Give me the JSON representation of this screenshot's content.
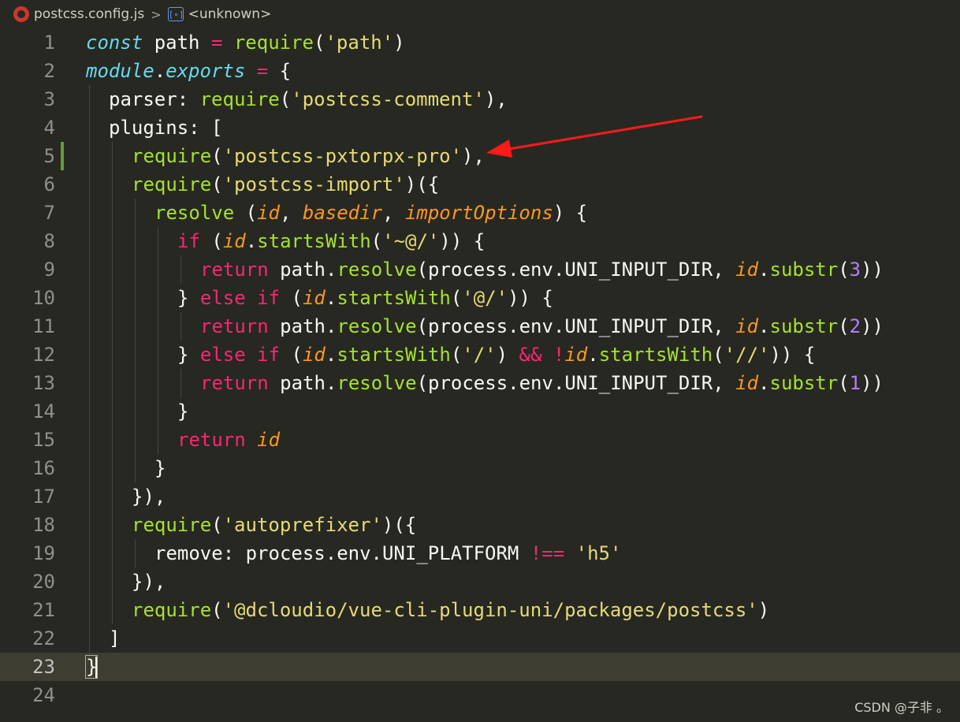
{
  "breadcrumb": {
    "file_icon": "postcss-file-icon",
    "file_name": "postcss.config.js",
    "separator": ">",
    "symbol_icon": "symbol-variable-icon",
    "symbol_icon_glyph": "[∘]",
    "symbol_name": "<unknown>"
  },
  "editor": {
    "current_line": 23,
    "modified_line": 5,
    "theme_colors": {
      "background": "#272822",
      "current_line_bg": "#3e3d32",
      "keyword": "#f92672",
      "function": "#a6e22e",
      "string": "#e6db74",
      "storage": "#66d9ef",
      "parameter": "#fd971f",
      "number": "#ae81ff",
      "foreground": "#f8f8f2",
      "gutter_fg": "#90908a",
      "change_marker": "#6a9a3a"
    },
    "lines": [
      {
        "num": "1",
        "indent": 0,
        "tokens": [
          [
            "storage-i",
            "const"
          ],
          [
            "plain",
            " path "
          ],
          [
            "op",
            "="
          ],
          [
            "plain",
            " "
          ],
          [
            "fn",
            "require"
          ],
          [
            "plain",
            "("
          ],
          [
            "str",
            "'path'"
          ],
          [
            "plain",
            ")"
          ]
        ]
      },
      {
        "num": "2",
        "indent": 0,
        "tokens": [
          [
            "storage-i",
            "module"
          ],
          [
            "plain",
            "."
          ],
          [
            "storage-i",
            "exports"
          ],
          [
            "plain",
            " "
          ],
          [
            "op",
            "="
          ],
          [
            "plain",
            " {"
          ]
        ]
      },
      {
        "num": "3",
        "indent": 1,
        "tokens": [
          [
            "plain",
            "parser: "
          ],
          [
            "fn",
            "require"
          ],
          [
            "plain",
            "("
          ],
          [
            "str",
            "'postcss-comment'"
          ],
          [
            "plain",
            "),"
          ]
        ]
      },
      {
        "num": "4",
        "indent": 1,
        "tokens": [
          [
            "plain",
            "plugins: ["
          ]
        ]
      },
      {
        "num": "5",
        "indent": 2,
        "tokens": [
          [
            "fn",
            "require"
          ],
          [
            "plain",
            "("
          ],
          [
            "str",
            "'postcss-pxtorpx-pro'"
          ],
          [
            "plain",
            "),"
          ]
        ]
      },
      {
        "num": "6",
        "indent": 2,
        "tokens": [
          [
            "fn",
            "require"
          ],
          [
            "plain",
            "("
          ],
          [
            "str",
            "'postcss-import'"
          ],
          [
            "plain",
            ")({"
          ]
        ]
      },
      {
        "num": "7",
        "indent": 3,
        "tokens": [
          [
            "fn",
            "resolve"
          ],
          [
            "plain",
            " ("
          ],
          [
            "param",
            "id"
          ],
          [
            "plain",
            ", "
          ],
          [
            "param",
            "basedir"
          ],
          [
            "plain",
            ", "
          ],
          [
            "param",
            "importOptions"
          ],
          [
            "plain",
            ") {"
          ]
        ]
      },
      {
        "num": "8",
        "indent": 4,
        "tokens": [
          [
            "kw",
            "if"
          ],
          [
            "plain",
            " ("
          ],
          [
            "param",
            "id"
          ],
          [
            "plain",
            "."
          ],
          [
            "fn",
            "startsWith"
          ],
          [
            "plain",
            "("
          ],
          [
            "str",
            "'~@/'"
          ],
          [
            "plain",
            ")) {"
          ]
        ]
      },
      {
        "num": "9",
        "indent": 5,
        "tokens": [
          [
            "kw",
            "return"
          ],
          [
            "plain",
            " path."
          ],
          [
            "fn",
            "resolve"
          ],
          [
            "plain",
            "(process.env.UNI_INPUT_DIR, "
          ],
          [
            "param",
            "id"
          ],
          [
            "plain",
            "."
          ],
          [
            "fn",
            "substr"
          ],
          [
            "plain",
            "("
          ],
          [
            "num",
            "3"
          ],
          [
            "plain",
            "))"
          ]
        ]
      },
      {
        "num": "10",
        "indent": 4,
        "tokens": [
          [
            "plain",
            "} "
          ],
          [
            "kw",
            "else"
          ],
          [
            "plain",
            " "
          ],
          [
            "kw",
            "if"
          ],
          [
            "plain",
            " ("
          ],
          [
            "param",
            "id"
          ],
          [
            "plain",
            "."
          ],
          [
            "fn",
            "startsWith"
          ],
          [
            "plain",
            "("
          ],
          [
            "str",
            "'@/'"
          ],
          [
            "plain",
            ")) {"
          ]
        ]
      },
      {
        "num": "11",
        "indent": 5,
        "tokens": [
          [
            "kw",
            "return"
          ],
          [
            "plain",
            " path."
          ],
          [
            "fn",
            "resolve"
          ],
          [
            "plain",
            "(process.env.UNI_INPUT_DIR, "
          ],
          [
            "param",
            "id"
          ],
          [
            "plain",
            "."
          ],
          [
            "fn",
            "substr"
          ],
          [
            "plain",
            "("
          ],
          [
            "num",
            "2"
          ],
          [
            "plain",
            "))"
          ]
        ]
      },
      {
        "num": "12",
        "indent": 4,
        "tokens": [
          [
            "plain",
            "} "
          ],
          [
            "kw",
            "else"
          ],
          [
            "plain",
            " "
          ],
          [
            "kw",
            "if"
          ],
          [
            "plain",
            " ("
          ],
          [
            "param",
            "id"
          ],
          [
            "plain",
            "."
          ],
          [
            "fn",
            "startsWith"
          ],
          [
            "plain",
            "("
          ],
          [
            "str",
            "'/'"
          ],
          [
            "plain",
            ") "
          ],
          [
            "op",
            "&&"
          ],
          [
            "plain",
            " "
          ],
          [
            "op",
            "!"
          ],
          [
            "param",
            "id"
          ],
          [
            "plain",
            "."
          ],
          [
            "fn",
            "startsWith"
          ],
          [
            "plain",
            "("
          ],
          [
            "str",
            "'//'"
          ],
          [
            "plain",
            ")) {"
          ]
        ]
      },
      {
        "num": "13",
        "indent": 5,
        "tokens": [
          [
            "kw",
            "return"
          ],
          [
            "plain",
            " path."
          ],
          [
            "fn",
            "resolve"
          ],
          [
            "plain",
            "(process.env.UNI_INPUT_DIR, "
          ],
          [
            "param",
            "id"
          ],
          [
            "plain",
            "."
          ],
          [
            "fn",
            "substr"
          ],
          [
            "plain",
            "("
          ],
          [
            "num",
            "1"
          ],
          [
            "plain",
            "))"
          ]
        ]
      },
      {
        "num": "14",
        "indent": 4,
        "tokens": [
          [
            "plain",
            "}"
          ]
        ]
      },
      {
        "num": "15",
        "indent": 4,
        "tokens": [
          [
            "kw",
            "return"
          ],
          [
            "plain",
            " "
          ],
          [
            "param",
            "id"
          ]
        ]
      },
      {
        "num": "16",
        "indent": 3,
        "tokens": [
          [
            "plain",
            "}"
          ]
        ]
      },
      {
        "num": "17",
        "indent": 2,
        "tokens": [
          [
            "plain",
            "}),"
          ]
        ]
      },
      {
        "num": "18",
        "indent": 2,
        "tokens": [
          [
            "fn",
            "require"
          ],
          [
            "plain",
            "("
          ],
          [
            "str",
            "'autoprefixer'"
          ],
          [
            "plain",
            ")({"
          ]
        ]
      },
      {
        "num": "19",
        "indent": 3,
        "tokens": [
          [
            "plain",
            "remove: process.env.UNI_PLATFORM "
          ],
          [
            "op",
            "!=="
          ],
          [
            "plain",
            " "
          ],
          [
            "str",
            "'h5'"
          ]
        ]
      },
      {
        "num": "20",
        "indent": 2,
        "tokens": [
          [
            "plain",
            "}),"
          ]
        ]
      },
      {
        "num": "21",
        "indent": 2,
        "tokens": [
          [
            "fn",
            "require"
          ],
          [
            "plain",
            "("
          ],
          [
            "str",
            "'@dcloudio/vue-cli-plugin-uni/packages/postcss'"
          ],
          [
            "plain",
            ")"
          ]
        ]
      },
      {
        "num": "22",
        "indent": 1,
        "tokens": [
          [
            "plain",
            "]"
          ]
        ]
      },
      {
        "num": "23",
        "indent": 0,
        "tokens": [
          [
            "bracket-match",
            "}"
          ]
        ]
      },
      {
        "num": "24",
        "indent": 0,
        "tokens": []
      }
    ]
  },
  "annotation": {
    "arrow_color": "#ff1a1a",
    "arrow_target": "require('postcss-pxtorpx-pro'),"
  },
  "watermark": "CSDN @子非 。"
}
